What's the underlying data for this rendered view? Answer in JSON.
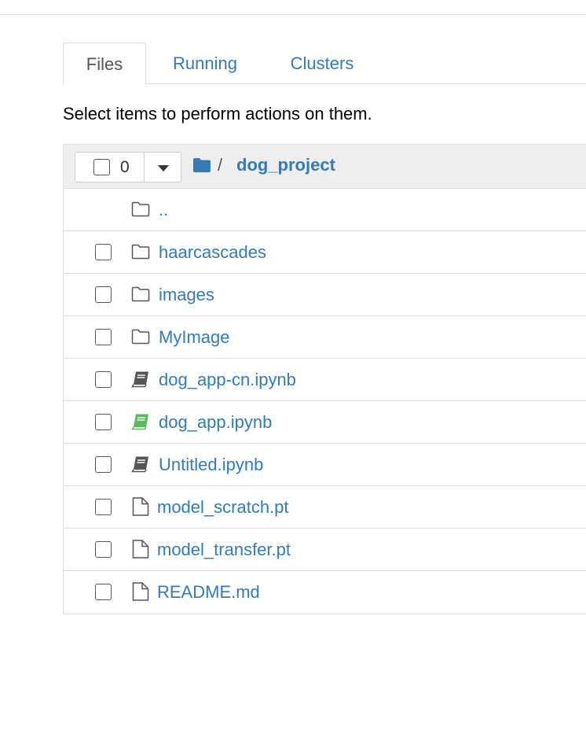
{
  "tabs": [
    {
      "label": "Files",
      "active": true
    },
    {
      "label": "Running",
      "active": false
    },
    {
      "label": "Clusters",
      "active": false
    }
  ],
  "instructions": "Select items to perform actions on them.",
  "list_header": {
    "selected_count": "0",
    "separator": "/",
    "breadcrumb": "dog_project"
  },
  "parent_dir": {
    "name": "..",
    "icon": "folder-icon"
  },
  "items": [
    {
      "name": "haarcascades",
      "type": "folder",
      "icon": "folder-icon"
    },
    {
      "name": "images",
      "type": "folder",
      "icon": "folder-icon"
    },
    {
      "name": "MyImage",
      "type": "folder",
      "icon": "folder-icon"
    },
    {
      "name": "dog_app-cn.ipynb",
      "type": "notebook",
      "icon": "notebook-icon",
      "running": false
    },
    {
      "name": "dog_app.ipynb",
      "type": "notebook",
      "icon": "notebook-icon",
      "running": true
    },
    {
      "name": "Untitled.ipynb",
      "type": "notebook",
      "icon": "notebook-icon",
      "running": false
    },
    {
      "name": "model_scratch.pt",
      "type": "file",
      "icon": "file-icon"
    },
    {
      "name": "model_transfer.pt",
      "type": "file",
      "icon": "file-icon"
    },
    {
      "name": "README.md",
      "type": "file",
      "icon": "file-icon"
    }
  ],
  "colors": {
    "link": "#337ab7",
    "running_notebook": "#5cb85c",
    "idle_notebook": "#555555",
    "header_bg": "#eeeeee"
  }
}
